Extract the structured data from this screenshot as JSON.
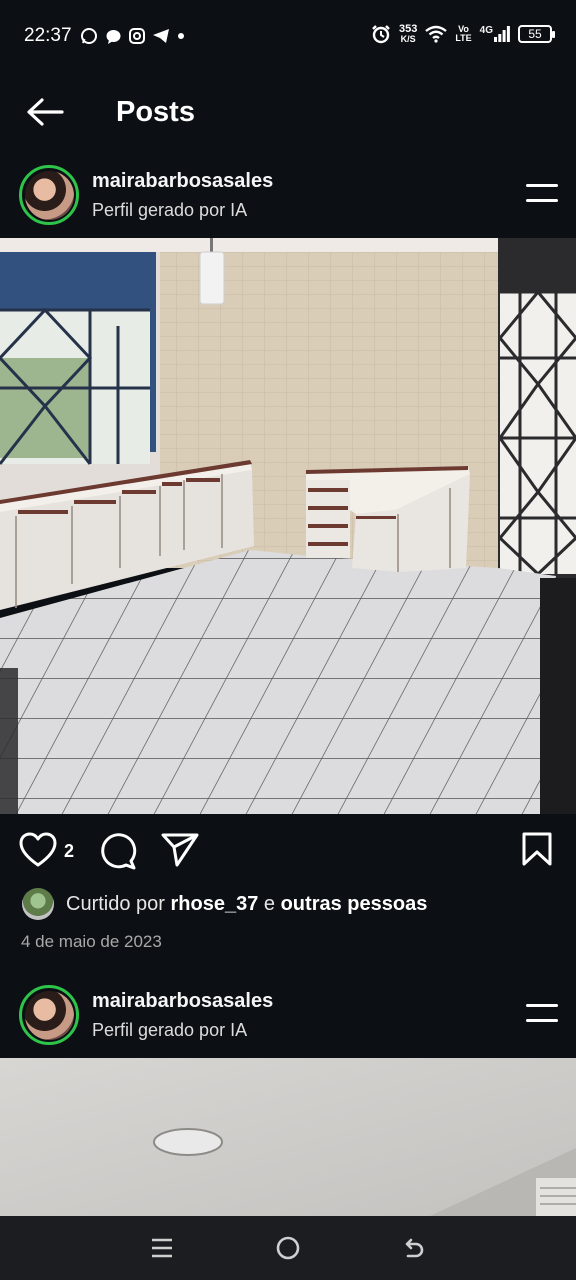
{
  "status": {
    "time": "22:37",
    "net_speed_value": "353",
    "net_speed_unit": "K/S",
    "volte_top": "Vo",
    "volte_bottom": "LTE",
    "signal_label": "4G",
    "battery": "55"
  },
  "header": {
    "title": "Posts"
  },
  "posts": [
    {
      "username": "mairabarbosasales",
      "subtitle": "Perfil gerado por IA",
      "like_count": "2",
      "liked_by_prefix": "Curtido por",
      "liked_by_user": "rhose_37",
      "liked_by_joiner": "e",
      "liked_by_others": "outras pessoas",
      "date": "4 de maio de 2023"
    },
    {
      "username": "mairabarbosasales",
      "subtitle": "Perfil gerado por IA"
    }
  ],
  "icons": {
    "back": "arrow-left-icon",
    "more": "menu-lines-icon",
    "like": "heart-icon",
    "comment": "comment-bubble-icon",
    "share": "paper-plane-icon",
    "save": "bookmark-icon"
  },
  "colors": {
    "background": "#0c1014",
    "story_ring": "#2ec44a",
    "text": "#f5f5f5",
    "muted": "#a8a8a8"
  }
}
